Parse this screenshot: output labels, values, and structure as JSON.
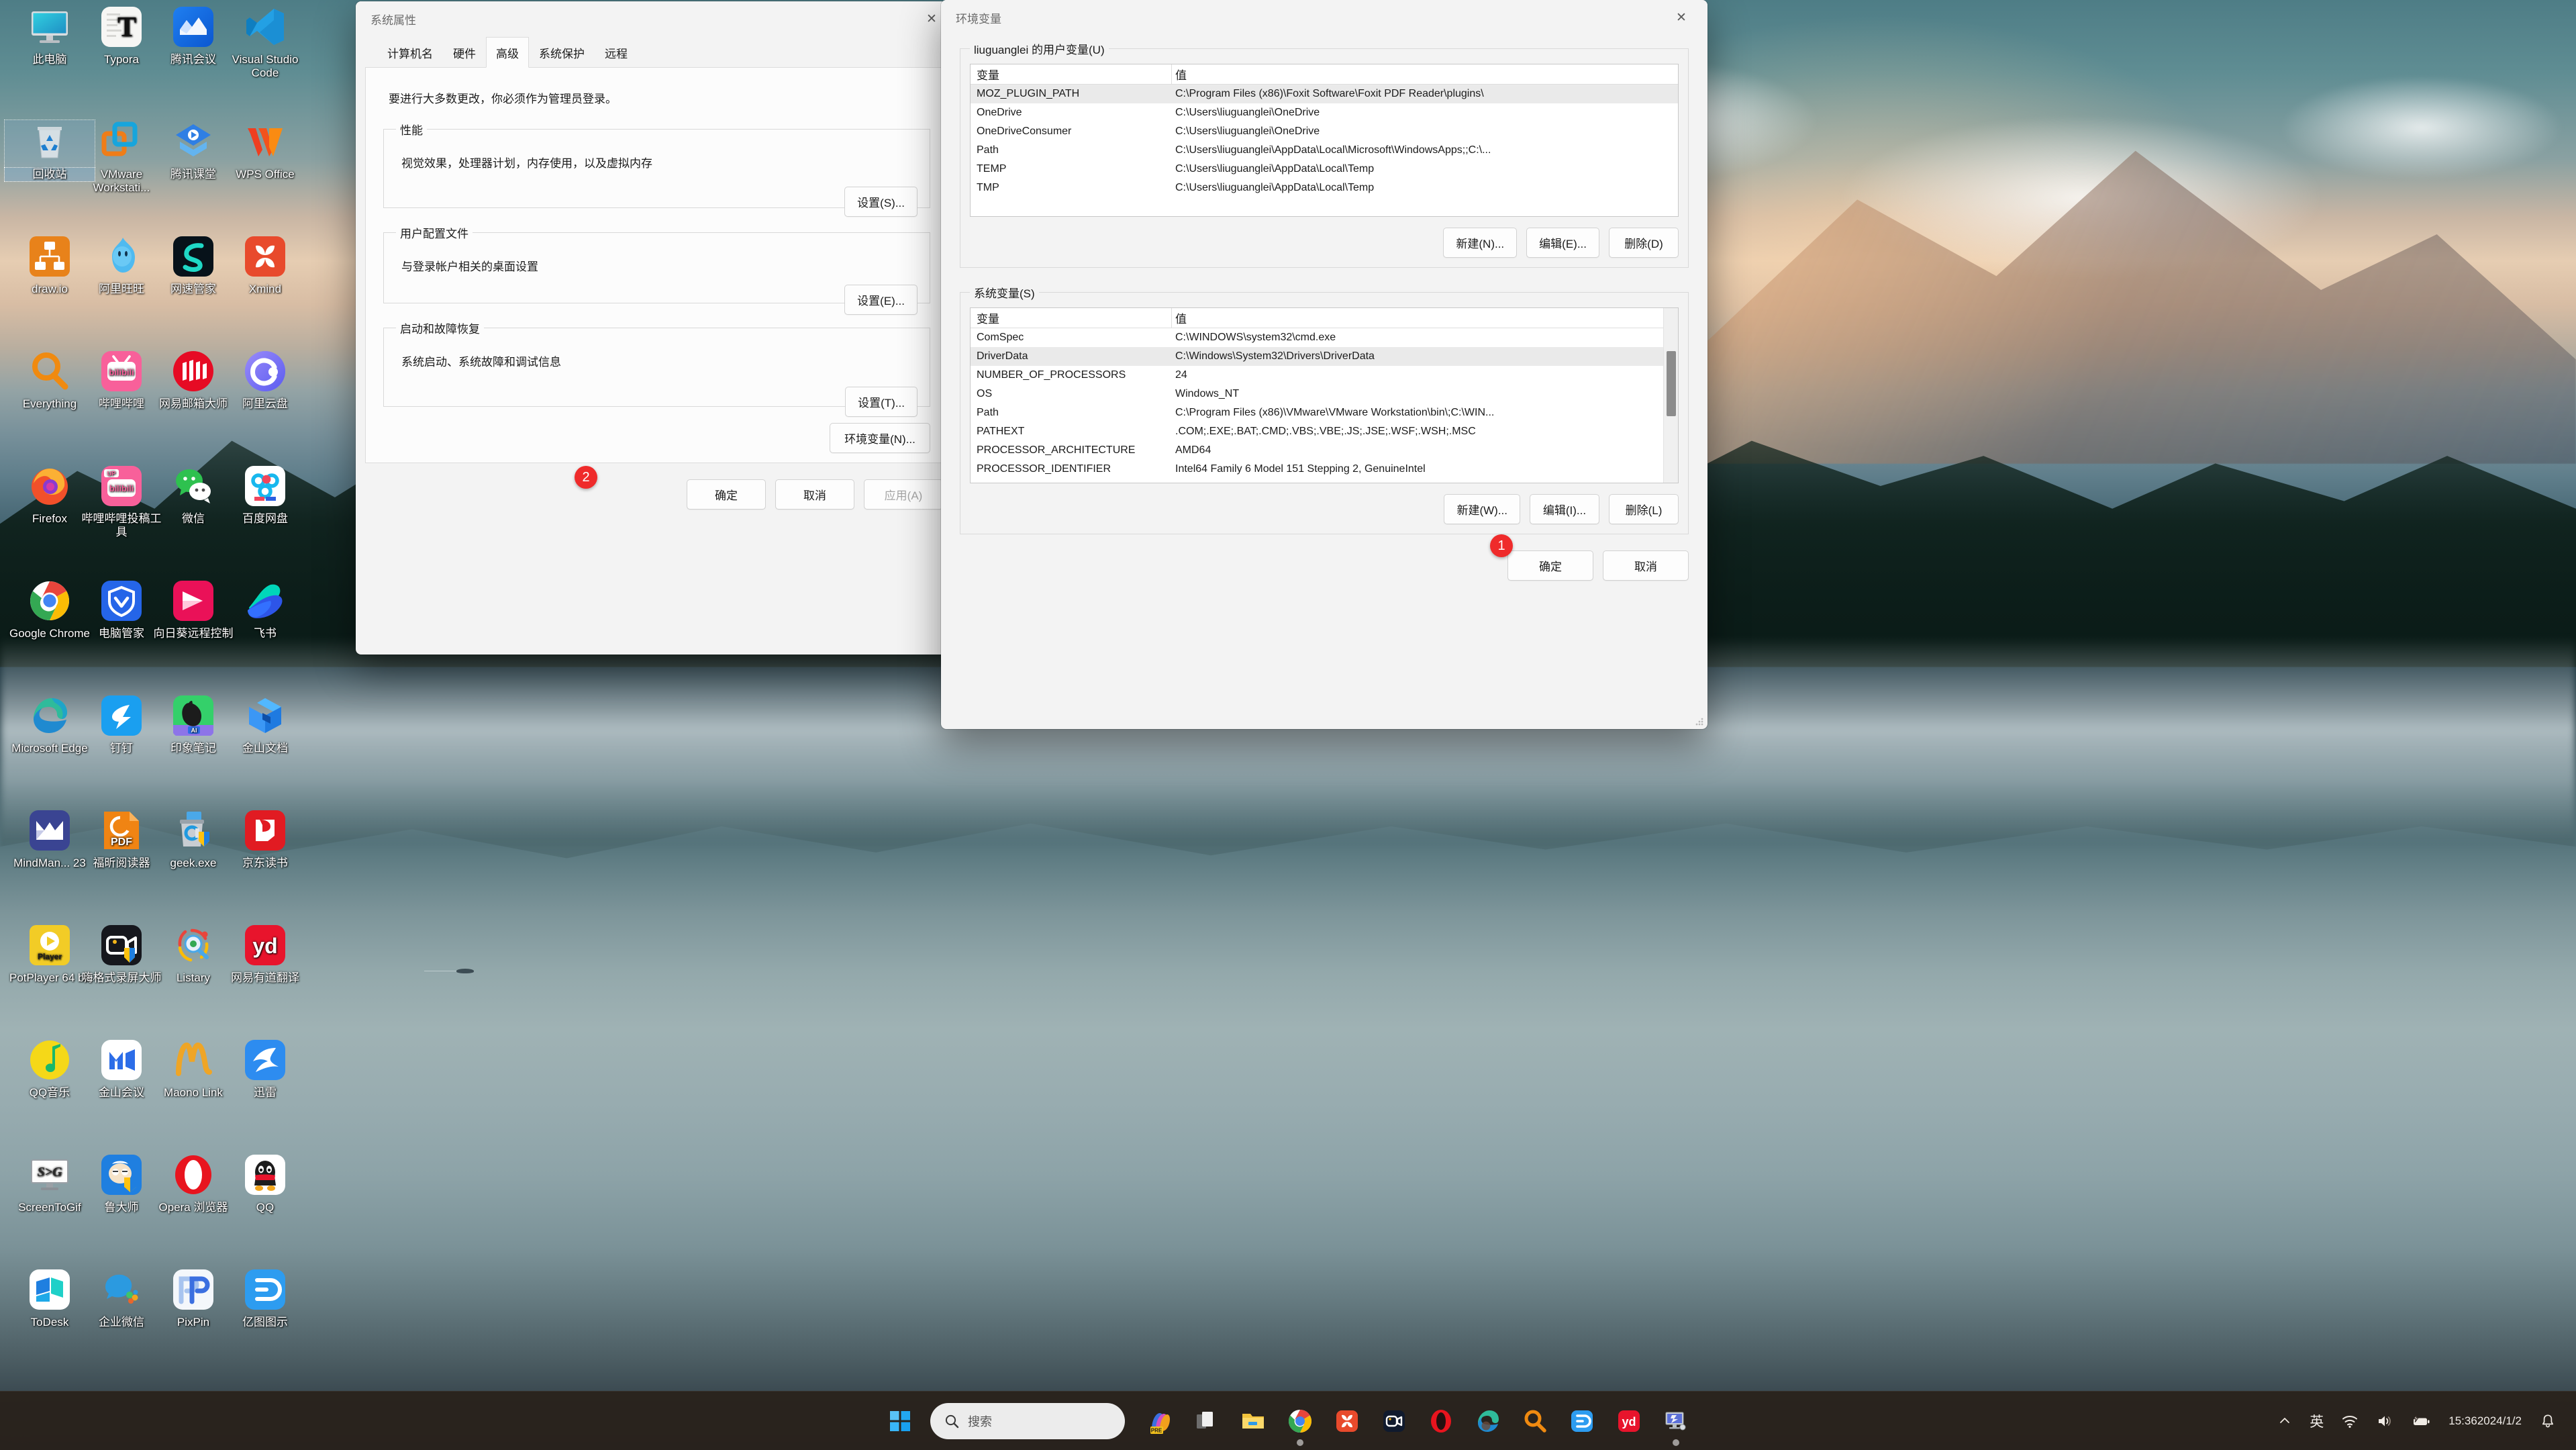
{
  "desktop": {
    "icons": [
      {
        "label": "此电脑",
        "icon": "this-pc-icon",
        "selected": false
      },
      {
        "label": "Typora",
        "icon": "typora-icon",
        "selected": false
      },
      {
        "label": "腾讯会议",
        "icon": "tencent-meeting-icon",
        "selected": false
      },
      {
        "label": "Visual Studio Code",
        "icon": "vscode-icon",
        "selected": false
      },
      {
        "label": "回收站",
        "icon": "recycle-bin-icon",
        "selected": true
      },
      {
        "label": "VMware Workstati...",
        "icon": "vmware-workstation-icon",
        "selected": false
      },
      {
        "label": "腾讯课堂",
        "icon": "tencent-ketang-icon",
        "selected": false
      },
      {
        "label": "WPS Office",
        "icon": "wps-office-icon",
        "selected": false
      },
      {
        "label": "draw.io",
        "icon": "drawio-icon",
        "selected": false
      },
      {
        "label": "阿里旺旺",
        "icon": "aliwangwang-icon",
        "selected": false
      },
      {
        "label": "网速管家",
        "icon": "wangsu-guanjia-icon",
        "selected": false
      },
      {
        "label": "Xmind",
        "icon": "xmind-icon",
        "selected": false
      },
      {
        "label": "Everything",
        "icon": "everything-icon",
        "selected": false
      },
      {
        "label": "哔哩哔哩",
        "icon": "bilibili-icon",
        "selected": false
      },
      {
        "label": "网易邮箱大师",
        "icon": "netease-mail-icon",
        "selected": false
      },
      {
        "label": "阿里云盘",
        "icon": "aliyun-drive-icon",
        "selected": false
      },
      {
        "label": "Firefox",
        "icon": "firefox-icon",
        "selected": false
      },
      {
        "label": "哔哩哔哩投稿工具",
        "icon": "bilibili-upload-icon",
        "selected": false
      },
      {
        "label": "微信",
        "icon": "wechat-icon",
        "selected": false
      },
      {
        "label": "百度网盘",
        "icon": "baidu-netdisk-icon",
        "selected": false
      },
      {
        "label": "Google Chrome",
        "icon": "chrome-icon",
        "selected": false
      },
      {
        "label": "电脑管家",
        "icon": "tencent-pc-manager-icon",
        "selected": false
      },
      {
        "label": "向日葵远程控制",
        "icon": "sunlogin-icon",
        "selected": false
      },
      {
        "label": "飞书",
        "icon": "feishu-icon",
        "selected": false
      },
      {
        "label": "Microsoft Edge",
        "icon": "edge-icon",
        "selected": false
      },
      {
        "label": "钉钉",
        "icon": "dingtalk-icon",
        "selected": false
      },
      {
        "label": "印象笔记",
        "icon": "evernote-icon",
        "selected": false
      },
      {
        "label": "金山文档",
        "icon": "kingsoft-docs-icon",
        "selected": false
      },
      {
        "label": "MindMan... 23",
        "icon": "mindmanager-icon",
        "selected": false
      },
      {
        "label": "福昕阅读器",
        "icon": "foxit-reader-icon",
        "selected": false
      },
      {
        "label": "geek.exe",
        "icon": "geek-uninstaller-icon",
        "selected": false
      },
      {
        "label": "京东读书",
        "icon": "jd-read-icon",
        "selected": false
      },
      {
        "label": "PotPlayer 64 bit",
        "icon": "potplayer-icon",
        "selected": false
      },
      {
        "label": "嗨格式录屏大师",
        "icon": "higeshi-recorder-icon",
        "selected": false
      },
      {
        "label": "Listary",
        "icon": "listary-icon",
        "selected": false
      },
      {
        "label": "网易有道翻译",
        "icon": "youdao-translate-icon",
        "selected": false
      },
      {
        "label": "QQ音乐",
        "icon": "qq-music-icon",
        "selected": false
      },
      {
        "label": "金山会议",
        "icon": "kingsoft-meeting-icon",
        "selected": false
      },
      {
        "label": "Maono Link",
        "icon": "maono-link-icon",
        "selected": false
      },
      {
        "label": "迅雷",
        "icon": "thunder-icon",
        "selected": false
      },
      {
        "label": "ScreenToGif",
        "icon": "screentogif-icon",
        "selected": false
      },
      {
        "label": "鲁大师",
        "icon": "ludashi-icon",
        "selected": false
      },
      {
        "label": "Opera 浏览器",
        "icon": "opera-icon",
        "selected": false
      },
      {
        "label": "QQ",
        "icon": "qq-icon",
        "selected": false
      },
      {
        "label": "ToDesk",
        "icon": "todesk-icon",
        "selected": false
      },
      {
        "label": "企业微信",
        "icon": "wecom-icon",
        "selected": false
      },
      {
        "label": "PixPin",
        "icon": "pixpin-icon",
        "selected": false
      },
      {
        "label": "亿图图示",
        "icon": "edraw-icon",
        "selected": false
      }
    ]
  },
  "system_properties": {
    "title": "系统属性",
    "close_label": "✕",
    "tabs": [
      {
        "label": "计算机名",
        "active": false
      },
      {
        "label": "硬件",
        "active": false
      },
      {
        "label": "高级",
        "active": true
      },
      {
        "label": "系统保护",
        "active": false
      },
      {
        "label": "远程",
        "active": false
      }
    ],
    "intro": "要进行大多数更改，你必须作为管理员登录。",
    "groups": [
      {
        "legend": "性能",
        "desc": "视觉效果，处理器计划，内存使用，以及虚拟内存",
        "button": "设置(S)..."
      },
      {
        "legend": "用户配置文件",
        "desc": "与登录帐户相关的桌面设置",
        "button": "设置(E)..."
      },
      {
        "legend": "启动和故障恢复",
        "desc": "系统启动、系统故障和调试信息",
        "button": "设置(T)..."
      }
    ],
    "env_button": "环境变量(N)...",
    "ok_label": "确定",
    "cancel_label": "取消",
    "apply_label": "应用(A)",
    "badge": "2"
  },
  "environment_variables": {
    "title": "环境变量",
    "close_label": "✕",
    "user_section": {
      "legend": "liuguanglei 的用户变量(U)",
      "columns": [
        "变量",
        "值"
      ],
      "rows": [
        {
          "name": "MOZ_PLUGIN_PATH",
          "value": "C:\\Program Files (x86)\\Foxit Software\\Foxit PDF Reader\\plugins\\",
          "selected": true
        },
        {
          "name": "OneDrive",
          "value": "C:\\Users\\liuguanglei\\OneDrive",
          "selected": false
        },
        {
          "name": "OneDriveConsumer",
          "value": "C:\\Users\\liuguanglei\\OneDrive",
          "selected": false
        },
        {
          "name": "Path",
          "value": "C:\\Users\\liuguanglei\\AppData\\Local\\Microsoft\\WindowsApps;;C:\\...",
          "selected": false
        },
        {
          "name": "TEMP",
          "value": "C:\\Users\\liuguanglei\\AppData\\Local\\Temp",
          "selected": false
        },
        {
          "name": "TMP",
          "value": "C:\\Users\\liuguanglei\\AppData\\Local\\Temp",
          "selected": false
        }
      ],
      "buttons": {
        "new": "新建(N)...",
        "edit": "编辑(E)...",
        "delete": "删除(D)"
      }
    },
    "system_section": {
      "legend": "系统变量(S)",
      "columns": [
        "变量",
        "值"
      ],
      "rows": [
        {
          "name": "ComSpec",
          "value": "C:\\WINDOWS\\system32\\cmd.exe",
          "selected": false
        },
        {
          "name": "DriverData",
          "value": "C:\\Windows\\System32\\Drivers\\DriverData",
          "selected": true
        },
        {
          "name": "NUMBER_OF_PROCESSORS",
          "value": "24",
          "selected": false
        },
        {
          "name": "OS",
          "value": "Windows_NT",
          "selected": false
        },
        {
          "name": "Path",
          "value": "C:\\Program Files (x86)\\VMware\\VMware Workstation\\bin\\;C:\\WIN...",
          "selected": false
        },
        {
          "name": "PATHEXT",
          "value": ".COM;.EXE;.BAT;.CMD;.VBS;.VBE;.JS;.JSE;.WSF;.WSH;.MSC",
          "selected": false
        },
        {
          "name": "PROCESSOR_ARCHITECTURE",
          "value": "AMD64",
          "selected": false
        },
        {
          "name": "PROCESSOR_IDENTIFIER",
          "value": "Intel64 Family 6 Model 151 Stepping 2, GenuineIntel",
          "selected": false
        }
      ],
      "buttons": {
        "new": "新建(W)...",
        "edit": "编辑(I)...",
        "delete": "删除(L)"
      }
    },
    "ok_label": "确定",
    "cancel_label": "取消",
    "badge": "1"
  },
  "taskbar": {
    "start_icon": "windows-start-icon",
    "search": {
      "placeholder": "搜索",
      "icon": "search-icon"
    },
    "items": [
      {
        "name": "copilot-icon",
        "label": "Copilot PRE",
        "running": false
      },
      {
        "name": "task-view-icon",
        "label": "任务视图",
        "running": false
      },
      {
        "name": "file-explorer-icon",
        "label": "文件资源管理器",
        "running": false
      },
      {
        "name": "chrome-icon",
        "label": "Google Chrome",
        "running": true
      },
      {
        "name": "xmind-icon",
        "label": "Xmind",
        "running": false
      },
      {
        "name": "tencent-meeting-icon",
        "label": "腾讯会议",
        "running": false
      },
      {
        "name": "opera-icon",
        "label": "Opera 浏览器",
        "running": false
      },
      {
        "name": "edge-icon",
        "label": "Microsoft Edge",
        "running": false
      },
      {
        "name": "everything-icon",
        "label": "Everything",
        "running": false
      },
      {
        "name": "edraw-icon",
        "label": "亿图图示",
        "running": false
      },
      {
        "name": "youdao-icon",
        "label": "网易有道翻译",
        "running": false
      },
      {
        "name": "system-properties-icon",
        "label": "系统属性",
        "running": true
      }
    ],
    "tray": {
      "chevron": "⌃",
      "ime": "英",
      "wifi_icon": "wifi-icon",
      "volume_icon": "volume-icon",
      "battery_icon": "battery-charging-icon",
      "time": "15:36",
      "date": "2024/1/2",
      "notification_icon": "bell-icon"
    }
  }
}
